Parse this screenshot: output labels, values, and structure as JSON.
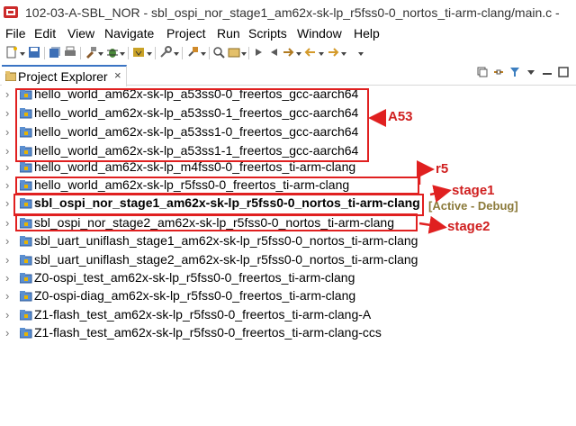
{
  "window": {
    "title": "102-03-A-SBL_NOR - sbl_ospi_nor_stage1_am62x-sk-lp_r5fss0-0_nortos_ti-arm-clang/main.c -"
  },
  "menubar": {
    "items": [
      "File",
      "Edit",
      "View",
      "Navigate",
      "Project",
      "Run",
      "Scripts",
      "Window",
      "Help"
    ]
  },
  "view": {
    "tab_label": "Project Explorer",
    "close_glyph": "×"
  },
  "projects": [
    {
      "name": "hello_world_am62x-sk-lp_a53ss0-0_freertos_gcc-aarch64",
      "bold": false
    },
    {
      "name": "hello_world_am62x-sk-lp_a53ss0-1_freertos_gcc-aarch64",
      "bold": false
    },
    {
      "name": "hello_world_am62x-sk-lp_a53ss1-0_freertos_gcc-aarch64",
      "bold": false
    },
    {
      "name": "hello_world_am62x-sk-lp_a53ss1-1_freertos_gcc-aarch64",
      "bold": false
    },
    {
      "name": "hello_world_am62x-sk-lp_m4fss0-0_freertos_ti-arm-clang",
      "bold": false
    },
    {
      "name": "hello_world_am62x-sk-lp_r5fss0-0_freertos_ti-arm-clang",
      "bold": false
    },
    {
      "name": "sbl_ospi_nor_stage1_am62x-sk-lp_r5fss0-0_nortos_ti-arm-clang",
      "bold": true
    },
    {
      "name": "sbl_ospi_nor_stage2_am62x-sk-lp_r5fss0-0_nortos_ti-arm-clang",
      "bold": false
    },
    {
      "name": "sbl_uart_uniflash_stage1_am62x-sk-lp_r5fss0-0_nortos_ti-arm-clang",
      "bold": false
    },
    {
      "name": "sbl_uart_uniflash_stage2_am62x-sk-lp_r5fss0-0_nortos_ti-arm-clang",
      "bold": false
    },
    {
      "name": "Z0-ospi_test_am62x-sk-lp_r5fss0-0_freertos_ti-arm-clang",
      "bold": false
    },
    {
      "name": "Z0-ospi-diag_am62x-sk-lp_r5fss0-0_freertos_ti-arm-clang",
      "bold": false
    },
    {
      "name": "Z1-flash_test_am62x-sk-lp_r5fss0-0_freertos_ti-arm-clang-A",
      "bold": false
    },
    {
      "name": "Z1-flash_test_am62x-sk-lp_r5fss0-0_freertos_ti-arm-clang-ccs",
      "bold": false
    }
  ],
  "active_suffix": "[Active - Debug]",
  "annotations": {
    "a53": "A53",
    "r5": "r5",
    "stage1": "stage1",
    "stage2": "stage2"
  },
  "icons": {
    "chevron": "›",
    "project_icon": "folder-project-icon"
  },
  "colors": {
    "annotation_red": "#e02020",
    "active_suffix": "#8b7a3a",
    "tab_accent": "#3a74c4"
  }
}
